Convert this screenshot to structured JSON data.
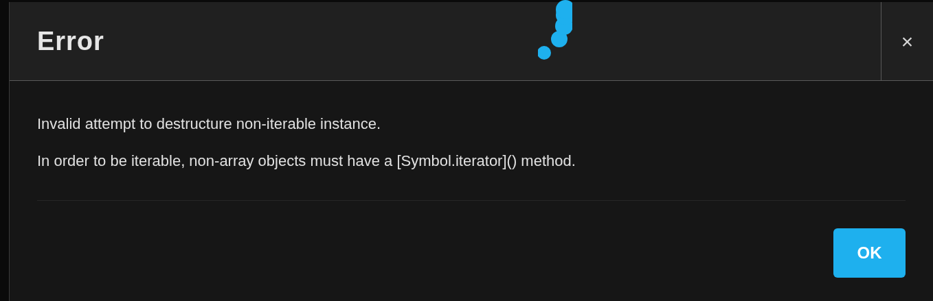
{
  "dialog": {
    "title": "Error",
    "close": "×",
    "message": [
      "Invalid attempt to destructure non-iterable instance.",
      "In order to be iterable, non-array objects must have a [Symbol.iterator]() method."
    ],
    "buttons": [
      "OK"
    ]
  }
}
